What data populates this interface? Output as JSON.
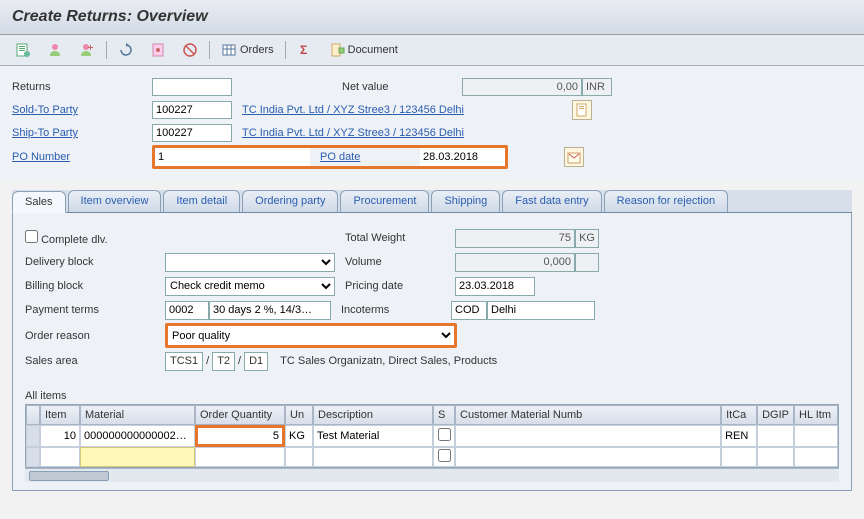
{
  "title": "Create Returns: Overview",
  "toolbar": {
    "orders": "Orders",
    "sigma_label": "",
    "document": "Document"
  },
  "header": {
    "returns_label": "Returns",
    "returns_value": "",
    "net_value_label": "Net value",
    "net_value": "0,00",
    "currency": "INR",
    "sold_to_label": "Sold-To Party",
    "sold_to_value": "100227",
    "sold_to_link": "TC India Pvt. Ltd / XYZ Stree3 / 123456 Delhi",
    "ship_to_label": "Ship-To Party",
    "ship_to_value": "100227",
    "ship_to_link": "TC India Pvt. Ltd / XYZ Stree3 / 123456 Delhi",
    "po_number_label": "PO Number",
    "po_number_value": "1",
    "po_date_label": "PO date",
    "po_date_value": "28.03.2018"
  },
  "tabs": [
    {
      "label": "Sales",
      "active": true
    },
    {
      "label": "Item overview"
    },
    {
      "label": "Item detail"
    },
    {
      "label": "Ordering party"
    },
    {
      "label": "Procurement"
    },
    {
      "label": "Shipping"
    },
    {
      "label": "Fast data entry"
    },
    {
      "label": "Reason for rejection"
    }
  ],
  "sales": {
    "complete_dlv_label": "Complete dlv.",
    "total_weight_label": "Total Weight",
    "total_weight": "75",
    "weight_unit": "KG",
    "delivery_block_label": "Delivery block",
    "delivery_block": "",
    "volume_label": "Volume",
    "volume": "0,000",
    "billing_block_label": "Billing block",
    "billing_block": "Check credit memo",
    "pricing_date_label": "Pricing date",
    "pricing_date": "23.03.2018",
    "payment_terms_label": "Payment terms",
    "payment_terms_code": "0002",
    "payment_terms_text": "30 days 2 %, 14/3…",
    "incoterms_label": "Incoterms",
    "incoterms_code": "COD",
    "incoterms_text": "Delhi",
    "order_reason_label": "Order reason",
    "order_reason": "Poor quality",
    "sales_area_label": "Sales area",
    "sales_area_1": "TCS1",
    "sales_area_2": "T2",
    "sales_area_3": "D1",
    "sales_area_text": "TC Sales Organizatn, Direct Sales, Products"
  },
  "items": {
    "section_label": "All items",
    "columns": [
      "Item",
      "Material",
      "Order Quantity",
      "Un",
      "Description",
      "S",
      "Customer Material Numb",
      "ItCa",
      "DGIP",
      "HL Itm"
    ],
    "rows": [
      {
        "item": "10",
        "material": "000000000000002…",
        "qty": "5",
        "un": "KG",
        "desc": "Test Material",
        "s": false,
        "cmn": "",
        "itca": "REN",
        "dgip": "",
        "hlitm": ""
      },
      {
        "item": "",
        "material": "",
        "qty": "",
        "un": "",
        "desc": "",
        "s": false,
        "cmn": "",
        "itca": "",
        "dgip": "",
        "hlitm": ""
      }
    ]
  }
}
